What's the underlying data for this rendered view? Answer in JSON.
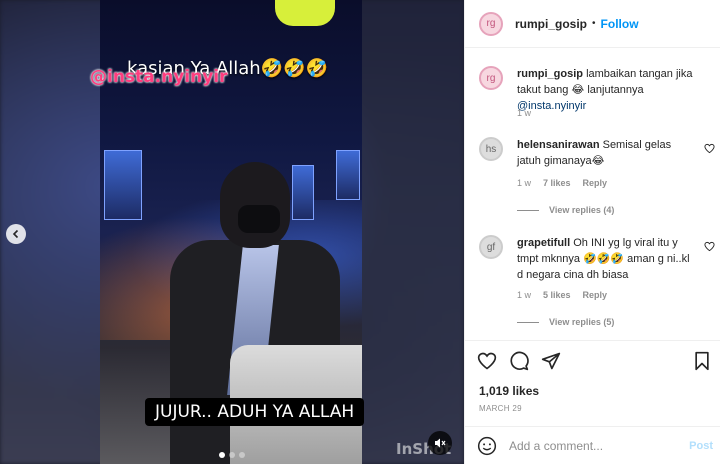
{
  "post": {
    "username": "rumpi_gosip",
    "separator": "•",
    "follow_label": "Follow",
    "avatar_initials": "rg"
  },
  "media": {
    "caption_top": "kasian Ya Allah🤣🤣🤣",
    "caption_handle": "@insta.nyinyir",
    "caption_bottom": "JUJUR.. ADUH YA ALLAH",
    "watermark": "InShot",
    "prev_icon": "chevron-left-icon",
    "mute_icon": "speaker-muted-icon",
    "slide_count": 3,
    "active_slide": 1
  },
  "caption": {
    "username": "rumpi_gosip",
    "text": " lambaikan tangan jika takut bang 😂 lanjutannya ",
    "mention": "@insta.nyinyir",
    "time": "1 w"
  },
  "comments": [
    {
      "username": "helensanirawan",
      "text": " Semisal gelas jatuh gimanaya😂",
      "time": "1 w",
      "likes": "7 likes",
      "reply_label": "Reply",
      "view_replies": "View replies (4)",
      "avatar_initials": "hs"
    },
    {
      "username": "grapetifull",
      "text": " Oh INI yg lg viral itu y tmpt mknnya 🤣🤣🤣 aman g ni..kl d negara cina dh biasa",
      "time": "1 w",
      "likes": "5 likes",
      "reply_label": "Reply",
      "view_replies": "View replies (5)",
      "avatar_initials": "gf"
    }
  ],
  "actions": {
    "like_icon": "heart-icon",
    "comment_icon": "comment-bubble-icon",
    "share_icon": "paper-plane-icon",
    "save_icon": "bookmark-icon",
    "likes_count": "1,019 likes",
    "date": "MARCH 29"
  },
  "add_comment": {
    "emoji_icon": "smiley-icon",
    "placeholder": "Add a comment...",
    "post_label": "Post"
  }
}
